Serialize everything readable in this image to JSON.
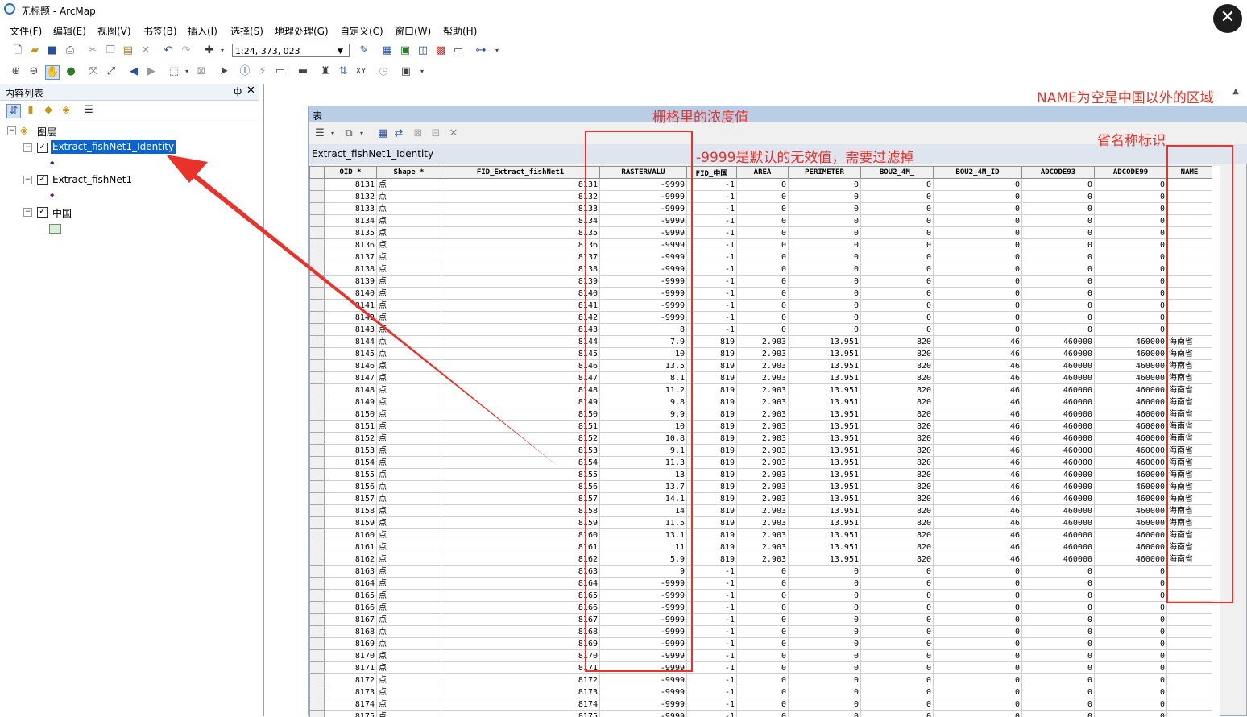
{
  "window": {
    "title": "无标题 - ArcMap",
    "close_symbol": "✕"
  },
  "menu": [
    "文件(F)",
    "编辑(E)",
    "视图(V)",
    "书签(B)",
    "插入(I)",
    "选择(S)",
    "地理处理(G)",
    "自定义(C)",
    "窗口(W)",
    "帮助(H)"
  ],
  "toolbar": {
    "scale": "1:24, 373, 023"
  },
  "toc": {
    "title": "内容列表",
    "pin_symbol": "ф",
    "close_symbol": "✕",
    "root_label": "图层",
    "layers": [
      {
        "name": "Extract_fishNet1_Identity",
        "checked": true,
        "selected": true
      },
      {
        "name": "Extract_fishNet1",
        "checked": true,
        "selected": false
      },
      {
        "name": "中国",
        "checked": true,
        "selected": false
      }
    ]
  },
  "table_window": {
    "title": "表",
    "table_name": "Extract_fishNet1_Identity",
    "columns": [
      "OID *",
      "Shape *",
      "FID_Extract_fishNet1",
      "RASTERVALU",
      "FID_中国",
      "AREA",
      "PERIMETER",
      "BOU2_4M_",
      "BOU2_4M_ID",
      "ADCODE93",
      "ADCODE99",
      "NAME"
    ],
    "rows": [
      [
        "8131",
        "点",
        "8131",
        "-9999",
        "-1",
        "0",
        "0",
        "0",
        "0",
        "0",
        "0",
        ""
      ],
      [
        "8132",
        "点",
        "8132",
        "-9999",
        "-1",
        "0",
        "0",
        "0",
        "0",
        "0",
        "0",
        ""
      ],
      [
        "8133",
        "点",
        "8133",
        "-9999",
        "-1",
        "0",
        "0",
        "0",
        "0",
        "0",
        "0",
        ""
      ],
      [
        "8134",
        "点",
        "8134",
        "-9999",
        "-1",
        "0",
        "0",
        "0",
        "0",
        "0",
        "0",
        ""
      ],
      [
        "8135",
        "点",
        "8135",
        "-9999",
        "-1",
        "0",
        "0",
        "0",
        "0",
        "0",
        "0",
        ""
      ],
      [
        "8136",
        "点",
        "8136",
        "-9999",
        "-1",
        "0",
        "0",
        "0",
        "0",
        "0",
        "0",
        ""
      ],
      [
        "8137",
        "点",
        "8137",
        "-9999",
        "-1",
        "0",
        "0",
        "0",
        "0",
        "0",
        "0",
        ""
      ],
      [
        "8138",
        "点",
        "8138",
        "-9999",
        "-1",
        "0",
        "0",
        "0",
        "0",
        "0",
        "0",
        ""
      ],
      [
        "8139",
        "点",
        "8139",
        "-9999",
        "-1",
        "0",
        "0",
        "0",
        "0",
        "0",
        "0",
        ""
      ],
      [
        "8140",
        "点",
        "8140",
        "-9999",
        "-1",
        "0",
        "0",
        "0",
        "0",
        "0",
        "0",
        ""
      ],
      [
        "8141",
        "点",
        "8141",
        "-9999",
        "-1",
        "0",
        "0",
        "0",
        "0",
        "0",
        "0",
        ""
      ],
      [
        "8142",
        "点",
        "8142",
        "-9999",
        "-1",
        "0",
        "0",
        "0",
        "0",
        "0",
        "0",
        ""
      ],
      [
        "8143",
        "点",
        "8143",
        "8",
        "-1",
        "0",
        "0",
        "0",
        "0",
        "0",
        "0",
        ""
      ],
      [
        "8144",
        "点",
        "8144",
        "7.9",
        "819",
        "2.903",
        "13.951",
        "820",
        "46",
        "460000",
        "460000",
        "海南省"
      ],
      [
        "8145",
        "点",
        "8145",
        "10",
        "819",
        "2.903",
        "13.951",
        "820",
        "46",
        "460000",
        "460000",
        "海南省"
      ],
      [
        "8146",
        "点",
        "8146",
        "13.5",
        "819",
        "2.903",
        "13.951",
        "820",
        "46",
        "460000",
        "460000",
        "海南省"
      ],
      [
        "8147",
        "点",
        "8147",
        "8.1",
        "819",
        "2.903",
        "13.951",
        "820",
        "46",
        "460000",
        "460000",
        "海南省"
      ],
      [
        "8148",
        "点",
        "8148",
        "11.2",
        "819",
        "2.903",
        "13.951",
        "820",
        "46",
        "460000",
        "460000",
        "海南省"
      ],
      [
        "8149",
        "点",
        "8149",
        "9.8",
        "819",
        "2.903",
        "13.951",
        "820",
        "46",
        "460000",
        "460000",
        "海南省"
      ],
      [
        "8150",
        "点",
        "8150",
        "9.9",
        "819",
        "2.903",
        "13.951",
        "820",
        "46",
        "460000",
        "460000",
        "海南省"
      ],
      [
        "8151",
        "点",
        "8151",
        "10",
        "819",
        "2.903",
        "13.951",
        "820",
        "46",
        "460000",
        "460000",
        "海南省"
      ],
      [
        "8152",
        "点",
        "8152",
        "10.8",
        "819",
        "2.903",
        "13.951",
        "820",
        "46",
        "460000",
        "460000",
        "海南省"
      ],
      [
        "8153",
        "点",
        "8153",
        "9.1",
        "819",
        "2.903",
        "13.951",
        "820",
        "46",
        "460000",
        "460000",
        "海南省"
      ],
      [
        "8154",
        "点",
        "8154",
        "11.3",
        "819",
        "2.903",
        "13.951",
        "820",
        "46",
        "460000",
        "460000",
        "海南省"
      ],
      [
        "8155",
        "点",
        "8155",
        "13",
        "819",
        "2.903",
        "13.951",
        "820",
        "46",
        "460000",
        "460000",
        "海南省"
      ],
      [
        "8156",
        "点",
        "8156",
        "13.7",
        "819",
        "2.903",
        "13.951",
        "820",
        "46",
        "460000",
        "460000",
        "海南省"
      ],
      [
        "8157",
        "点",
        "8157",
        "14.1",
        "819",
        "2.903",
        "13.951",
        "820",
        "46",
        "460000",
        "460000",
        "海南省"
      ],
      [
        "8158",
        "点",
        "8158",
        "14",
        "819",
        "2.903",
        "13.951",
        "820",
        "46",
        "460000",
        "460000",
        "海南省"
      ],
      [
        "8159",
        "点",
        "8159",
        "11.5",
        "819",
        "2.903",
        "13.951",
        "820",
        "46",
        "460000",
        "460000",
        "海南省"
      ],
      [
        "8160",
        "点",
        "8160",
        "13.1",
        "819",
        "2.903",
        "13.951",
        "820",
        "46",
        "460000",
        "460000",
        "海南省"
      ],
      [
        "8161",
        "点",
        "8161",
        "11",
        "819",
        "2.903",
        "13.951",
        "820",
        "46",
        "460000",
        "460000",
        "海南省"
      ],
      [
        "8162",
        "点",
        "8162",
        "5.9",
        "819",
        "2.903",
        "13.951",
        "820",
        "46",
        "460000",
        "460000",
        "海南省"
      ],
      [
        "8163",
        "点",
        "8163",
        "9",
        "-1",
        "0",
        "0",
        "0",
        "0",
        "0",
        "0",
        ""
      ],
      [
        "8164",
        "点",
        "8164",
        "-9999",
        "-1",
        "0",
        "0",
        "0",
        "0",
        "0",
        "0",
        ""
      ],
      [
        "8165",
        "点",
        "8165",
        "-9999",
        "-1",
        "0",
        "0",
        "0",
        "0",
        "0",
        "0",
        ""
      ],
      [
        "8166",
        "点",
        "8166",
        "-9999",
        "-1",
        "0",
        "0",
        "0",
        "0",
        "0",
        "0",
        ""
      ],
      [
        "8167",
        "点",
        "8167",
        "-9999",
        "-1",
        "0",
        "0",
        "0",
        "0",
        "0",
        "0",
        ""
      ],
      [
        "8168",
        "点",
        "8168",
        "-9999",
        "-1",
        "0",
        "0",
        "0",
        "0",
        "0",
        "0",
        ""
      ],
      [
        "8169",
        "点",
        "8169",
        "-9999",
        "-1",
        "0",
        "0",
        "0",
        "0",
        "0",
        "0",
        ""
      ],
      [
        "8170",
        "点",
        "8170",
        "-9999",
        "-1",
        "0",
        "0",
        "0",
        "0",
        "0",
        "0",
        ""
      ],
      [
        "8171",
        "点",
        "8171",
        "-9999",
        "-1",
        "0",
        "0",
        "0",
        "0",
        "0",
        "0",
        ""
      ],
      [
        "8172",
        "点",
        "8172",
        "-9999",
        "-1",
        "0",
        "0",
        "0",
        "0",
        "0",
        "0",
        ""
      ],
      [
        "8173",
        "点",
        "8173",
        "-9999",
        "-1",
        "0",
        "0",
        "0",
        "0",
        "0",
        "0",
        ""
      ],
      [
        "8174",
        "点",
        "8174",
        "-9999",
        "-1",
        "0",
        "0",
        "0",
        "0",
        "0",
        "0",
        ""
      ],
      [
        "8175",
        "点",
        "8175",
        "-9999",
        "-1",
        "0",
        "0",
        "0",
        "0",
        "0",
        "0",
        ""
      ]
    ]
  },
  "annotations": {
    "name_note": "NAME为空是中国以外的区域",
    "raster_note": "栅格里的浓度值",
    "invalid_note": "-9999是默认的无效值，需要过滤掉",
    "province_note": "省名称标识",
    "color": "#e8322a"
  }
}
